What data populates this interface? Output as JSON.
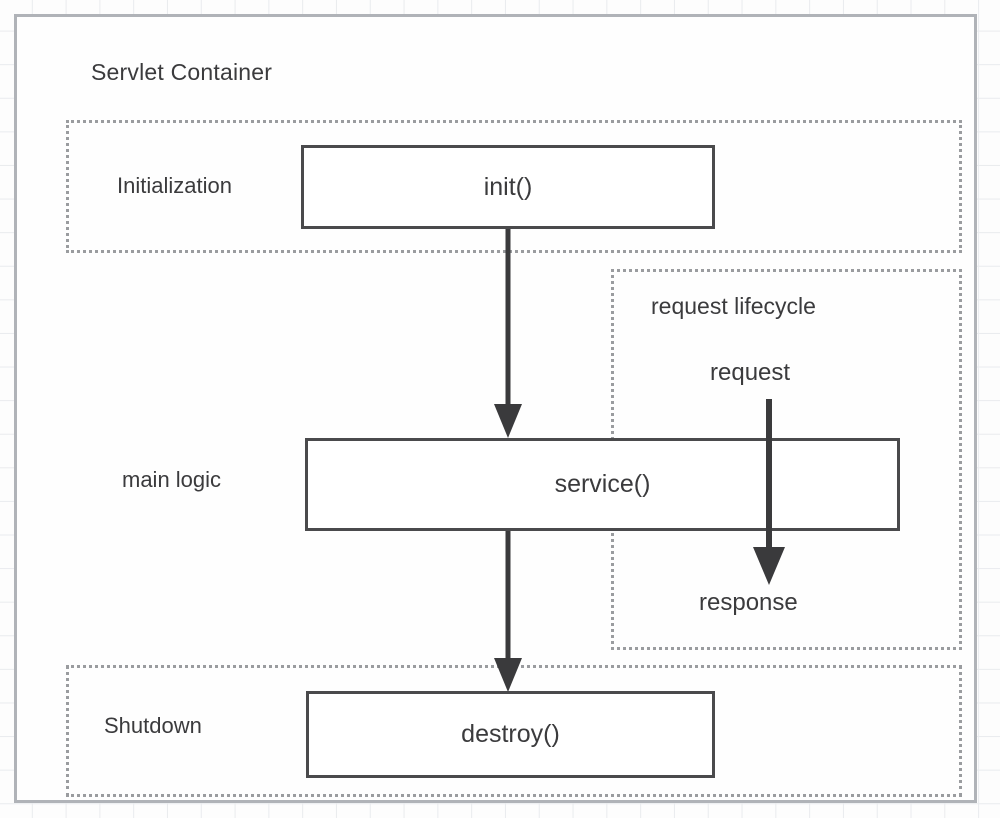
{
  "diagram": {
    "title": "Servlet Container",
    "bands": [
      {
        "id": "initialization",
        "label": "Initialization"
      },
      {
        "id": "main-logic",
        "label": "main logic"
      },
      {
        "id": "shutdown",
        "label": "Shutdown"
      },
      {
        "id": "request-lifecycle",
        "label": "request lifecycle"
      }
    ],
    "boxes": [
      {
        "id": "init",
        "label": "init()"
      },
      {
        "id": "service",
        "label": "service()"
      },
      {
        "id": "destroy",
        "label": "destroy()"
      }
    ],
    "flow_labels": {
      "request": "request",
      "response": "response"
    },
    "colors": {
      "box_border": "#4a4a4c",
      "band_border": "#9a9c9f",
      "container_border": "#b0b3b8",
      "text": "#3b3b3d",
      "grid": "#e9ebee",
      "background": "#fdfdfd"
    }
  }
}
